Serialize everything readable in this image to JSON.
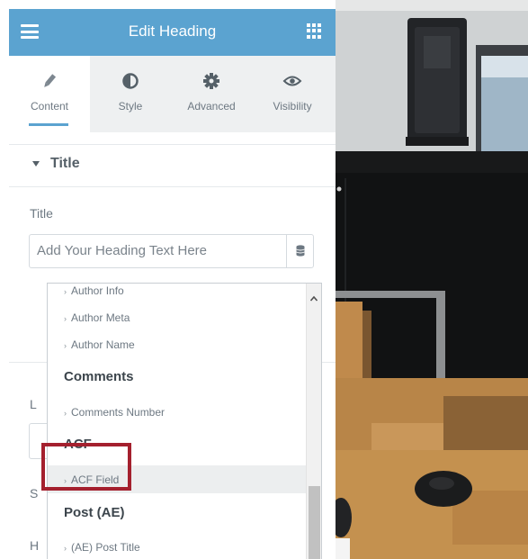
{
  "header": {
    "title": "Edit Heading",
    "menu_icon": "hamburger-icon",
    "apps_icon": "grid-icon"
  },
  "tabs": [
    {
      "label": "Content",
      "icon": "pencil-icon",
      "active": true
    },
    {
      "label": "Style",
      "icon": "contrast-icon",
      "active": false
    },
    {
      "label": "Advanced",
      "icon": "gear-icon",
      "active": false
    },
    {
      "label": "Visibility",
      "icon": "eye-icon",
      "active": false
    }
  ],
  "section": {
    "title": "Title"
  },
  "title_field": {
    "label": "Title",
    "placeholder": "Add Your Heading Text Here",
    "dynamic_icon": "database-icon"
  },
  "hidden_field_letters": {
    "first": "L",
    "second": "S",
    "third": "H"
  },
  "dropdown": {
    "items": [
      {
        "type": "option",
        "label": "Author Info"
      },
      {
        "type": "option",
        "label": "Author Meta"
      },
      {
        "type": "option",
        "label": "Author Name"
      },
      {
        "type": "group",
        "label": "Comments"
      },
      {
        "type": "option",
        "label": "Comments Number"
      },
      {
        "type": "group",
        "label": "ACF"
      },
      {
        "type": "option",
        "label": "ACF Field",
        "highlighted": true
      },
      {
        "type": "group",
        "label": "Post (AE)"
      },
      {
        "type": "option",
        "label": "(AE) Post Title"
      }
    ]
  },
  "colors": {
    "accent": "#5ba3d0",
    "highlight_box": "#a4202e",
    "panel_bg": "#ffffff",
    "tab_bar_bg": "#eef0f1"
  }
}
